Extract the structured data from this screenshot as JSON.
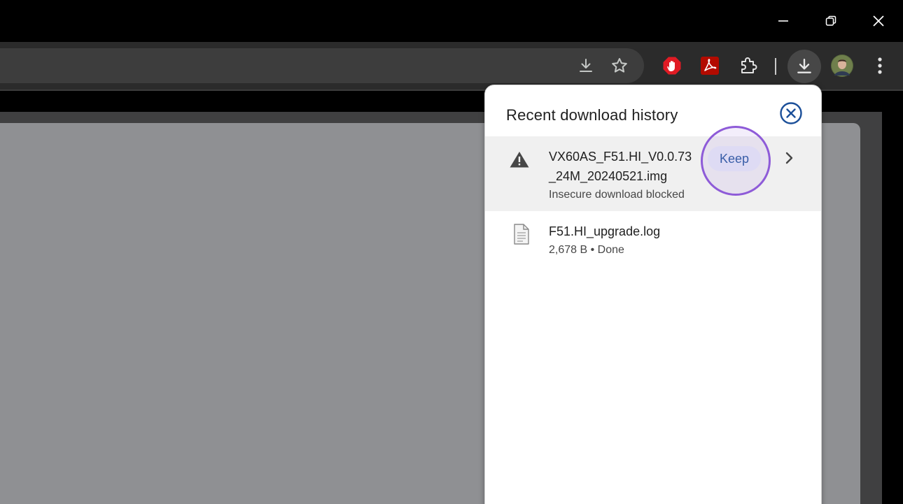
{
  "downloads_panel": {
    "title": "Recent download history",
    "items": [
      {
        "filename_line1": "VX60AS_F51.HI_V0.0.73",
        "filename_line2": "_24M_20240521.img",
        "status": "Insecure download blocked",
        "action_label": "Keep",
        "icon": "warning-icon"
      },
      {
        "filename_line1": "F51.HI_upgrade.log",
        "status": "2,678 B • Done",
        "icon": "file-icon"
      }
    ]
  },
  "toolbar_icons": [
    "download-icon",
    "bookmark-star-icon",
    "hand-stop-extension-icon",
    "pdf-extension-icon",
    "puzzle-extensions-icon",
    "downloads-button-icon",
    "profile-avatar",
    "more-menu-icon"
  ],
  "window_controls": [
    "minimize-icon",
    "restore-icon",
    "close-icon"
  ],
  "colors": {
    "accent_blue": "#1b4f99",
    "highlight_ring": "#8e5bd8",
    "extension_red": "#e01b24"
  }
}
